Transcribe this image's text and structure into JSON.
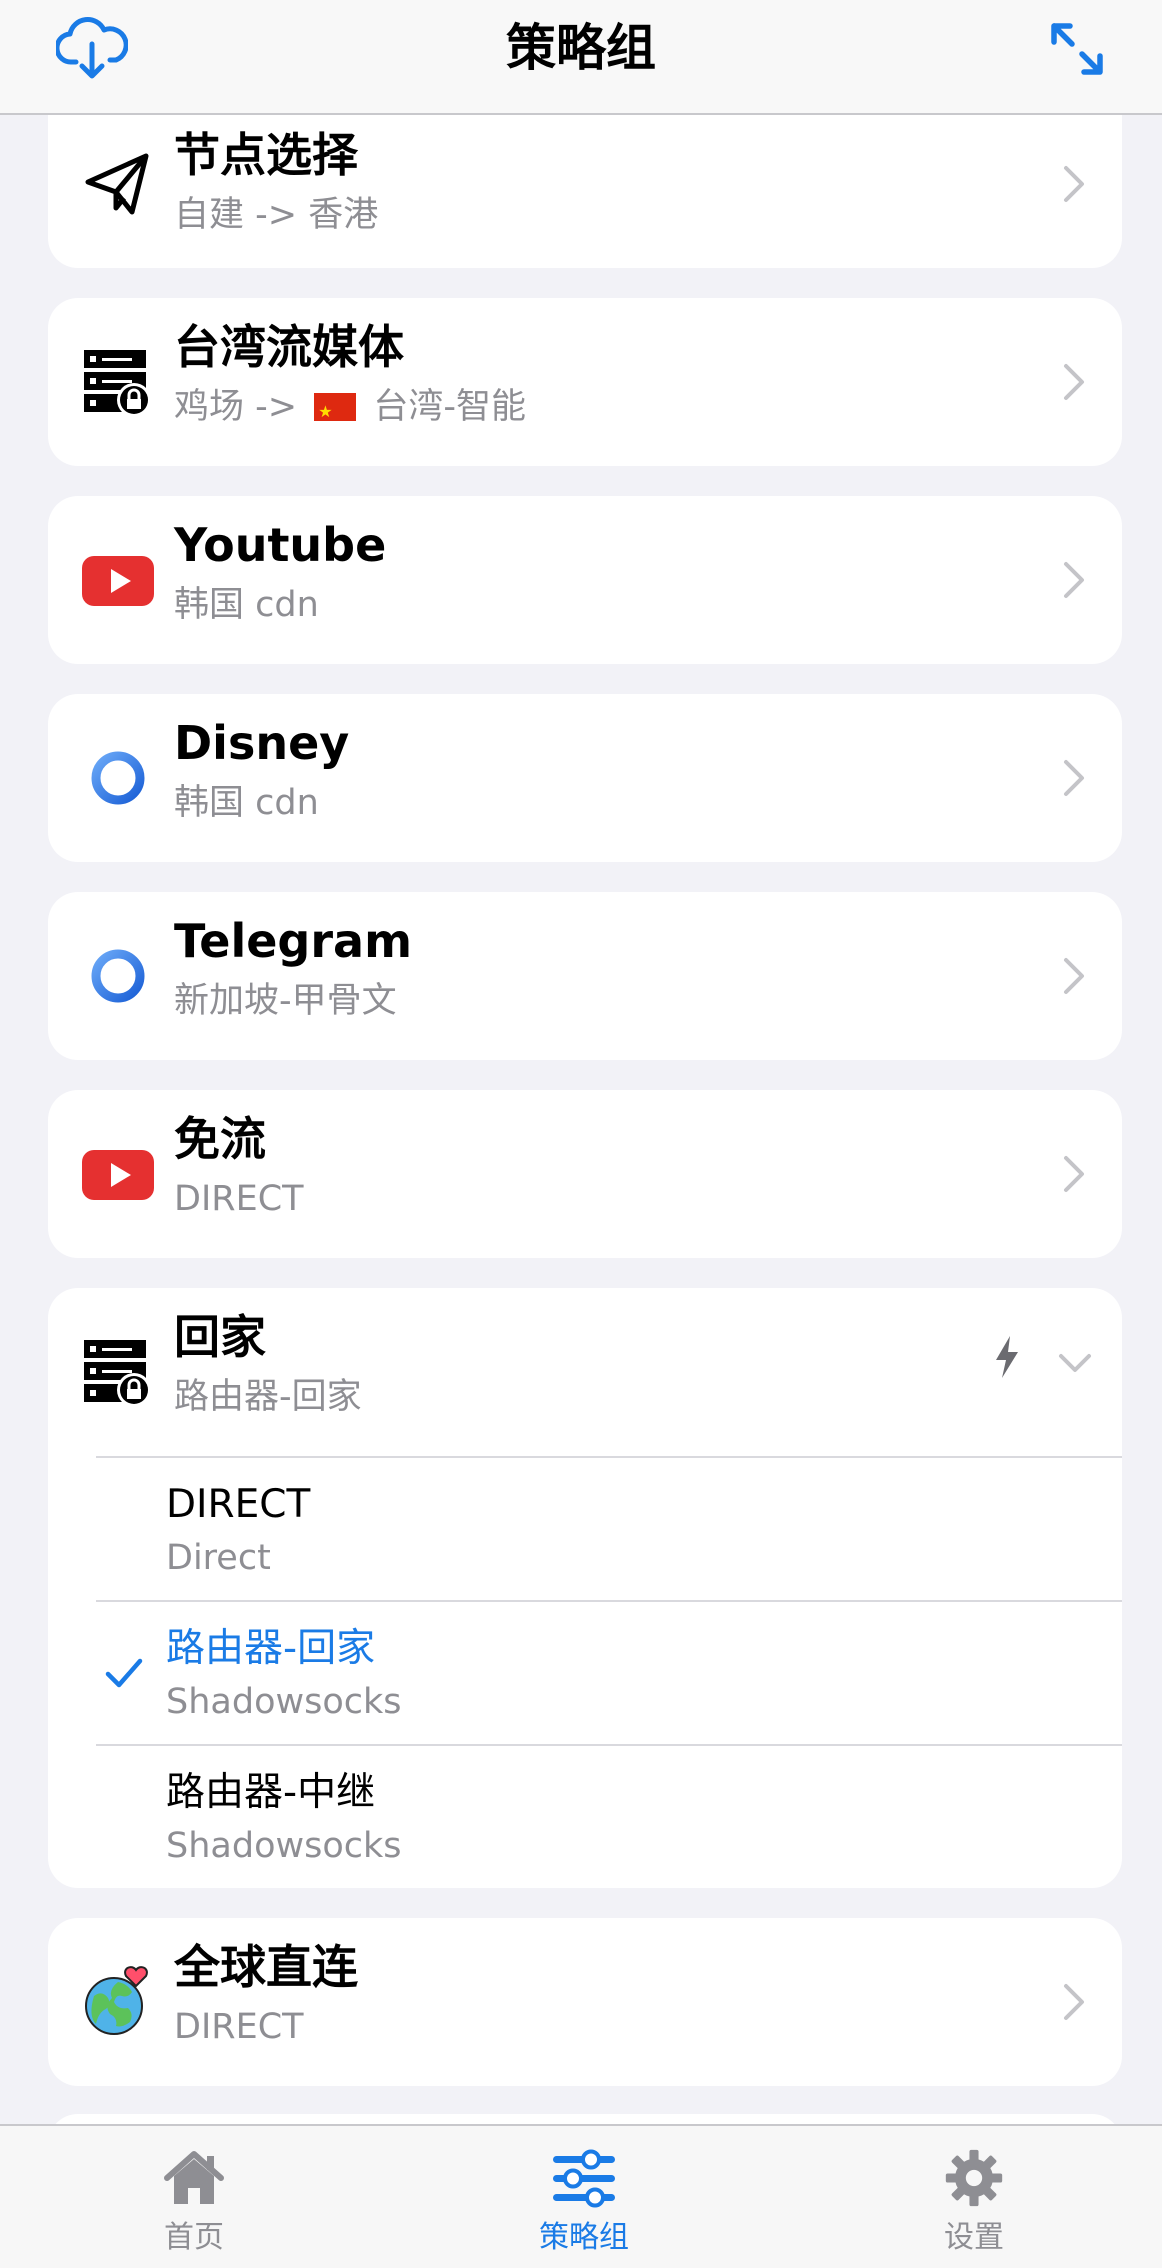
{
  "header": {
    "title": "策略组"
  },
  "groups": [
    {
      "name": "节点选择",
      "sub": "自建 -> 香港",
      "icon": "paper-plane-icon"
    },
    {
      "name": "台湾流媒体",
      "sub_prefix": "鸡场 ->",
      "sub_suffix": "台湾-智能",
      "icon": "server-lock-icon",
      "flag_icon": "china-flag-icon"
    },
    {
      "name": "Youtube",
      "sub": "韩国 cdn",
      "icon": "youtube-icon"
    },
    {
      "name": "Disney",
      "sub": "韩国 cdn",
      "icon": "ring-icon"
    },
    {
      "name": "Telegram",
      "sub": "新加坡-甲骨文",
      "icon": "ring-icon"
    },
    {
      "name": "免流",
      "sub": "DIRECT",
      "icon": "youtube-icon"
    },
    {
      "name": "回家",
      "sub": "路由器-回家",
      "icon": "server-lock-icon",
      "expanded": true
    },
    {
      "name": "全球直连",
      "sub": "DIRECT",
      "icon": "globe-heart-icon"
    }
  ],
  "expanded_options": [
    {
      "name": "DIRECT",
      "type": "Direct",
      "selected": false
    },
    {
      "name": "路由器-回家",
      "type": "Shadowsocks",
      "selected": true
    },
    {
      "name": "路由器-中继",
      "type": "Shadowsocks",
      "selected": false
    }
  ],
  "tabs": [
    {
      "label": "首页",
      "icon": "home-icon",
      "active": false
    },
    {
      "label": "策略组",
      "icon": "sliders-icon",
      "active": true
    },
    {
      "label": "设置",
      "icon": "gear-icon",
      "active": false
    }
  ],
  "colors": {
    "accent": "#1a7be6",
    "youtube_red": "#e53030",
    "secondary_text": "#8e8e93"
  }
}
